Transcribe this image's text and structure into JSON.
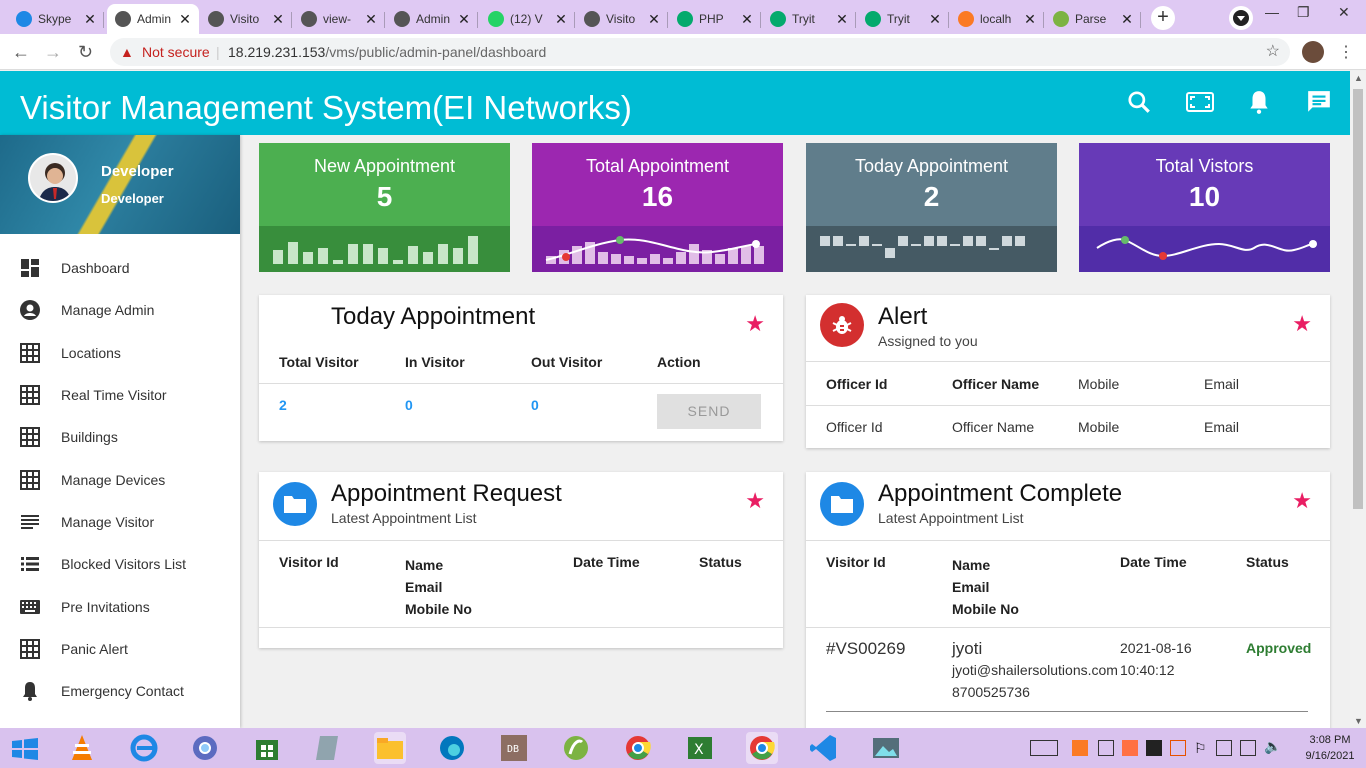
{
  "browser": {
    "tabs": [
      {
        "label": "Skype",
        "icon": "skype-icon",
        "color": "#1e88e5"
      },
      {
        "label": "Admin",
        "icon": "globe-icon",
        "color": "#555555",
        "active": true
      },
      {
        "label": "Visito",
        "icon": "globe-icon",
        "color": "#555555"
      },
      {
        "label": "view-",
        "icon": "globe-icon",
        "color": "#555555"
      },
      {
        "label": "Admin",
        "icon": "globe-icon",
        "color": "#555555"
      },
      {
        "label": "(12) V",
        "icon": "whatsapp-icon",
        "color": "#25d366"
      },
      {
        "label": "Visito",
        "icon": "globe-icon",
        "color": "#555555"
      },
      {
        "label": "PHP",
        "icon": "w3schools-icon",
        "color": "#04aa6d"
      },
      {
        "label": "Tryit",
        "icon": "w3schools-icon",
        "color": "#04aa6d"
      },
      {
        "label": "Tryit",
        "icon": "w3schools-icon",
        "color": "#04aa6d"
      },
      {
        "label": "localh",
        "icon": "xampp-icon",
        "color": "#fb7a24"
      },
      {
        "label": "Parse",
        "icon": "leaf-icon",
        "color": "#7cb342"
      }
    ],
    "not_secure": "Not secure",
    "url_host": "18.219.231.153",
    "url_path": "/vms/public/admin-panel/dashboard"
  },
  "header": {
    "title": "Visitor Management System(EI Networks)",
    "accent": "#00bcd4"
  },
  "profile": {
    "name": "Developer",
    "role": "Developer"
  },
  "sidebar": {
    "items": [
      {
        "label": "Dashboard",
        "icon": "dashboard-icon"
      },
      {
        "label": "Manage Admin",
        "icon": "account-circle-icon"
      },
      {
        "label": "Locations",
        "icon": "grid-icon"
      },
      {
        "label": "Real Time Visitor",
        "icon": "grid-icon"
      },
      {
        "label": "Buildings",
        "icon": "grid-icon"
      },
      {
        "label": "Manage Devices",
        "icon": "grid-icon"
      },
      {
        "label": "Manage Visitor",
        "icon": "lines-icon"
      },
      {
        "label": "Blocked Visitors List",
        "icon": "list-icon"
      },
      {
        "label": "Pre Invitations",
        "icon": "keyboard-icon"
      },
      {
        "label": "Panic Alert",
        "icon": "grid-icon"
      },
      {
        "label": "Emergency Contact",
        "icon": "bell-icon"
      }
    ]
  },
  "stats": [
    {
      "label": "New Appointment",
      "value": "5",
      "color": "#4caf50",
      "dark": "#388e3c"
    },
    {
      "label": "Total Appointment",
      "value": "16",
      "color": "#9c27b0",
      "dark": "#7b1fa2"
    },
    {
      "label": "Today Appointment",
      "value": "2",
      "color": "#607d8b",
      "dark": "#455a64"
    },
    {
      "label": "Total Vistors",
      "value": "10",
      "color": "#673ab7",
      "dark": "#512da8"
    }
  ],
  "today_card": {
    "title": "Today Appointment",
    "headers": [
      "Total Visitor",
      "In Visitor",
      "Out Visitor",
      "Action"
    ],
    "values": [
      "2",
      "0",
      "0"
    ],
    "send_label": "SEND"
  },
  "alert_card": {
    "title": "Alert",
    "subtitle": "Assigned to you",
    "headers": [
      "Officer Id",
      "Officer Name",
      "Mobile",
      "Email"
    ],
    "row": [
      "Officer Id",
      "Officer Name",
      "Mobile",
      "Email"
    ]
  },
  "request_card": {
    "title": "Appointment Request",
    "subtitle": "Latest Appointment List",
    "headers": {
      "id": "Visitor Id",
      "name": "Name",
      "email": "Email",
      "mobile": "Mobile No",
      "date": "Date Time",
      "status": "Status"
    }
  },
  "complete_card": {
    "title": "Appointment Complete",
    "subtitle": "Latest Appointment List",
    "headers": {
      "id": "Visitor Id",
      "name": "Name",
      "email": "Email",
      "mobile": "Mobile No",
      "date": "Date Time",
      "status": "Status"
    },
    "rows": [
      {
        "id": "#VS00269",
        "name": "jyoti",
        "email": "jyoti@shailersolutions.com",
        "mobile": "8700525736",
        "date": "2021-08-16",
        "time": "10:40:12",
        "status": "Approved"
      }
    ]
  },
  "taskbar": {
    "time": "3:08 PM",
    "date": "9/16/2021"
  }
}
